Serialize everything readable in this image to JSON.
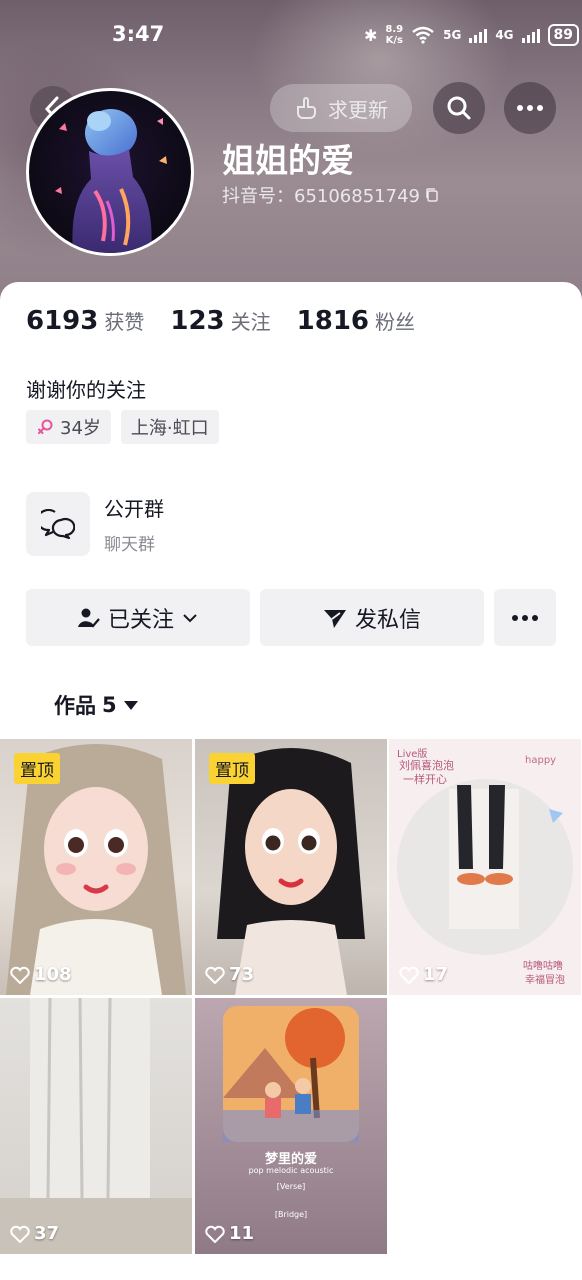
{
  "status": {
    "time": "3:47",
    "speed_value": "8.9",
    "speed_unit": "K/s",
    "net1": "5G",
    "net2": "4G",
    "battery": "89"
  },
  "header": {
    "update_label": "求更新",
    "username": "姐姐的爱",
    "douyin_id": "抖音号：65106851749"
  },
  "stats": [
    {
      "num": "6193",
      "label": "获赞"
    },
    {
      "num": "123",
      "label": "关注"
    },
    {
      "num": "1816",
      "label": "粉丝"
    }
  ],
  "bio": "谢谢你的关注",
  "tags": {
    "age": "34岁",
    "location": "上海·虹口"
  },
  "group": {
    "title": "公开群",
    "subtitle": "聊天群"
  },
  "actions": {
    "follow_label": "已关注",
    "message_label": "发私信"
  },
  "works": {
    "tab_label": "作品",
    "count": "5"
  },
  "videos": [
    {
      "pinned_label": "置顶",
      "likes": "108"
    },
    {
      "pinned_label": "置顶",
      "likes": "73"
    },
    {
      "likes": "17",
      "cover_text": [
        "Live版",
        "刘佩喜泡泡",
        "一样开心",
        "happy",
        "咕噜咕噜",
        "幸福冒泡"
      ]
    },
    {
      "likes": "37"
    },
    {
      "likes": "11",
      "cover_title": "梦里的爱",
      "cover_sub": "pop melodic acoustic",
      "cover_verse": "[Verse]",
      "cover_bridge": "[Bridge]"
    }
  ],
  "colors": {
    "pin_badge": "#fad232",
    "female_icon": "#e8559a",
    "text_primary": "#161823",
    "text_secondary": "#6b6e78"
  }
}
